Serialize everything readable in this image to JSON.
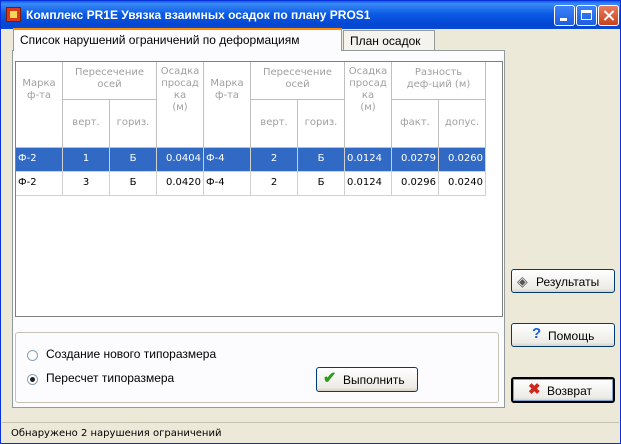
{
  "window": {
    "title": "Комплекс PR1E  Увязка взаимных осадок по плану PROS1"
  },
  "tabs": [
    {
      "label": "Список нарушений ограничений по деформациям"
    },
    {
      "label": "План осадок"
    }
  ],
  "grid": {
    "headers": {
      "mark1": "Марка\nф-та",
      "cross1": "Пересечение\nосей",
      "vert1": "верт.",
      "horiz1": "гориз.",
      "settle1": "Осадка\nпросад\nка\n(м)",
      "mark2": "Марка\nф-та",
      "cross2": "Пересечение\nосей",
      "vert2": "верт.",
      "horiz2": "гориз.",
      "settle2": "Осадка\nпросад\nка\n(м)",
      "diff": "Разность\nдеф-ций (м)",
      "fact": "факт.",
      "allowed": "допус."
    },
    "rows": [
      [
        "Ф-2",
        "1",
        "Б",
        "0.0404",
        "Ф-4",
        "2",
        "Б",
        "0.0124",
        "0.0279",
        "0.0260"
      ],
      [
        "Ф-2",
        "3",
        "Б",
        "0.0420",
        "Ф-4",
        "2",
        "Б",
        "0.0124",
        "0.0296",
        "0.0240"
      ]
    ]
  },
  "options": {
    "create_label": "Создание нового типоразмера",
    "recalc_label": "Пересчет типоразмера",
    "selected": "recalc"
  },
  "buttons": {
    "execute": "Выполнить",
    "results": "Результаты",
    "help": "Помощь",
    "back": "Возврат"
  },
  "status": {
    "text": "Обнаружено 2 нарушения ограничений"
  },
  "colors": {
    "selection": "#316ac5",
    "titlebar": "#0b5ce6"
  }
}
